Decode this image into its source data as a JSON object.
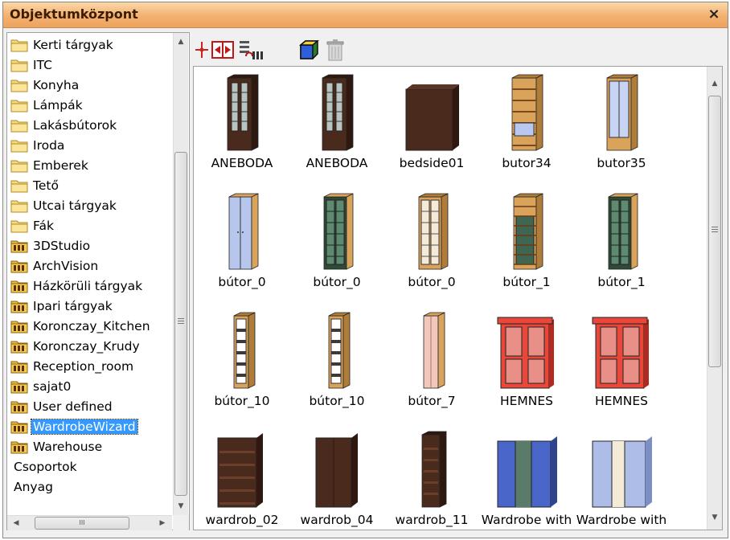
{
  "window": {
    "title": "Objektumközpont",
    "close_glyph": "×"
  },
  "tree": {
    "folders": [
      {
        "label": "Kerti tárgyak",
        "icon": "folder-icon"
      },
      {
        "label": "ITC",
        "icon": "folder-icon"
      },
      {
        "label": "Konyha",
        "icon": "folder-icon"
      },
      {
        "label": "Lámpák",
        "icon": "folder-icon"
      },
      {
        "label": "Lakásbútorok",
        "icon": "folder-icon"
      },
      {
        "label": "Iroda",
        "icon": "folder-icon"
      },
      {
        "label": "Emberek",
        "icon": "folder-icon"
      },
      {
        "label": "Tető",
        "icon": "folder-icon"
      },
      {
        "label": "Utcai tárgyak",
        "icon": "folder-icon"
      },
      {
        "label": "Fák",
        "icon": "folder-icon"
      },
      {
        "label": "3DStudio",
        "icon": "library-icon"
      },
      {
        "label": "ArchVision",
        "icon": "library-icon"
      },
      {
        "label": "Házkörüli tárgyak",
        "icon": "library-icon"
      },
      {
        "label": "Ipari tárgyak",
        "icon": "library-icon"
      },
      {
        "label": "Koronczay_Kitchen",
        "icon": "library-icon"
      },
      {
        "label": "Koronczay_Krudy",
        "icon": "library-icon"
      },
      {
        "label": "Reception_room",
        "icon": "library-icon"
      },
      {
        "label": "sajat0",
        "icon": "library-icon"
      },
      {
        "label": "User defined",
        "icon": "library-icon"
      },
      {
        "label": "WardrobeWizard",
        "icon": "library-icon",
        "selected": true
      },
      {
        "label": "Warehouse",
        "icon": "library-icon"
      },
      {
        "label": "Csoportok",
        "icon": ""
      },
      {
        "label": "Anyag",
        "icon": ""
      }
    ],
    "hscroll_grip": "III"
  },
  "toolbar": {
    "buttons": [
      {
        "name": "insert-point-icon"
      },
      {
        "name": "move-icon"
      },
      {
        "name": "list-view-icon"
      },
      {
        "name": "3d-view-icon"
      },
      {
        "name": "trash-icon"
      }
    ]
  },
  "objects": [
    {
      "name": "ANEBODA",
      "style": "dark-glass"
    },
    {
      "name": "ANEBODA",
      "style": "dark-glass"
    },
    {
      "name": "bedside01",
      "style": "dark-box"
    },
    {
      "name": "butor34",
      "style": "light-shelf"
    },
    {
      "name": "butor35",
      "style": "light-glass"
    },
    {
      "name": "bútor_0",
      "style": "light-door"
    },
    {
      "name": "bútor_0",
      "style": "green-glass"
    },
    {
      "name": "bútor_0",
      "style": "cream-glass"
    },
    {
      "name": "bútor_1",
      "style": "green-shelf"
    },
    {
      "name": "bútor_1",
      "style": "green-narrow"
    },
    {
      "name": "bútor_10",
      "style": "open-narrow"
    },
    {
      "name": "bútor_10",
      "style": "open-narrow"
    },
    {
      "name": "bútor_7",
      "style": "pink-narrow"
    },
    {
      "name": "HEMNES",
      "style": "red-hutch"
    },
    {
      "name": "HEMNES",
      "style": "red-hutch"
    },
    {
      "name": "wardrob_02",
      "style": "dark-open"
    },
    {
      "name": "wardrob_04",
      "style": "dark-door"
    },
    {
      "name": "wardrob_11",
      "style": "dark-narrow"
    },
    {
      "name": "Wardrobe with",
      "style": "blue-wardrobe"
    },
    {
      "name": "Wardrobe with",
      "style": "lightblue-wardrobe"
    }
  ],
  "colors": {
    "titlebar": "#f3b070",
    "selection": "#3399ff",
    "wood_dark": "#4a2a1c",
    "wood_light": "#d9a35c",
    "red_cabinet": "#e8473a"
  }
}
